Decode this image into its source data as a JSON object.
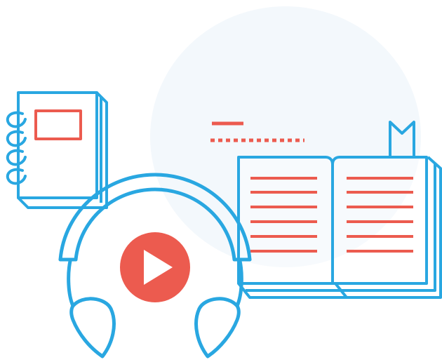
{
  "illustration": {
    "elements": [
      "notebook-icon",
      "headphones-icon",
      "play-icon",
      "open-book-icon",
      "bookmark-icon",
      "text-lines-decoration"
    ]
  },
  "colors": {
    "blue": "#29a7e1",
    "red": "#ec5b4f",
    "circle": "#f3f8fc",
    "background": "#ffffff"
  }
}
